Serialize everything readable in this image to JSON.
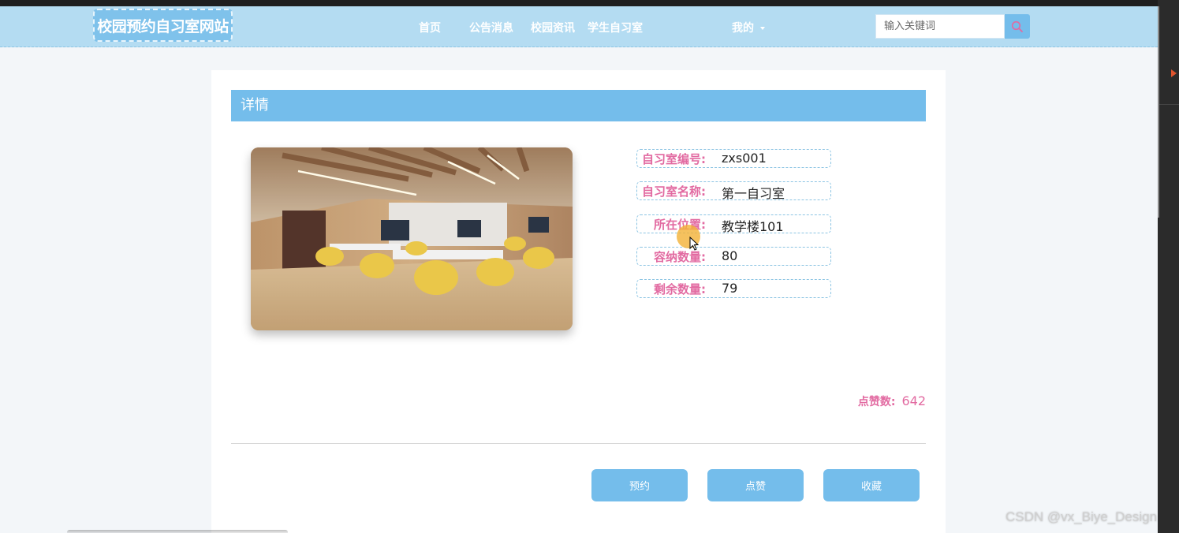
{
  "header": {
    "logo": "校园预约自习室网站",
    "nav": [
      "首页",
      "公告消息",
      "校园资讯",
      "学生自习室"
    ],
    "mine": "我的",
    "search_placeholder": "输入关键词"
  },
  "detail": {
    "title": "详情",
    "fields": [
      {
        "label": "自习室编号:",
        "value": "zxs001"
      },
      {
        "label": "自习室名称:",
        "value": "第一自习室"
      },
      {
        "label": "所在位置:",
        "value": "教学楼101"
      },
      {
        "label": "容纳数量:",
        "value": "80"
      },
      {
        "label": "剩余数量:",
        "value": "79"
      }
    ],
    "likes_label": "点赞数:",
    "likes_value": "642"
  },
  "actions": [
    "预约",
    "点赞",
    "收藏"
  ],
  "watermark": "CSDN @vx_Biye_Design",
  "colors": {
    "header_bg": "#b4dcf2",
    "accent": "#74bdeb",
    "label_pink": "#e26aa1"
  }
}
